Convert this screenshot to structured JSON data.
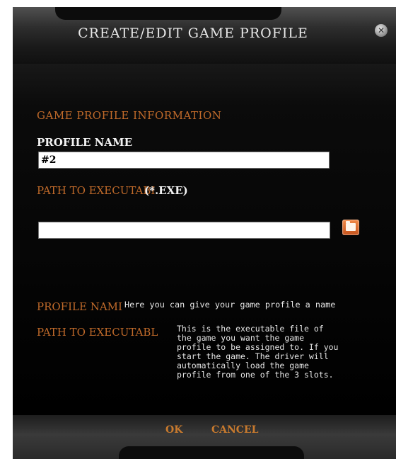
{
  "window": {
    "title": "CREATE/EDIT GAME PROFILE",
    "close_icon": "x-circle-icon",
    "close_glyph": "✕"
  },
  "form": {
    "section_heading": "GAME PROFILE INFORMATION",
    "profile_name_label": "PROFILE NAME",
    "profile_name_value": "#2",
    "path_label": "PATH TO EXECUTABI",
    "path_suffix": "(*.EXE)",
    "path_value": "",
    "browse_icon": "folder-icon"
  },
  "help": {
    "profile_name_label": "PROFILE NAMI",
    "profile_name_text": "Here you can give your game profile a name",
    "path_label": "PATH TO EXECUTABL",
    "path_text": "This is the executable file of\nthe game you want the game\nprofile to be assigned to. If you\nstart the game. The driver will\nautomatically load the game\nprofile from one of the 3 slots."
  },
  "footer": {
    "ok_label": "OK",
    "cancel_label": "CANCEL"
  },
  "colors": {
    "accent_orange": "#c06a2a",
    "background": "#0c0c0c",
    "text_light": "#f2f2f2"
  }
}
